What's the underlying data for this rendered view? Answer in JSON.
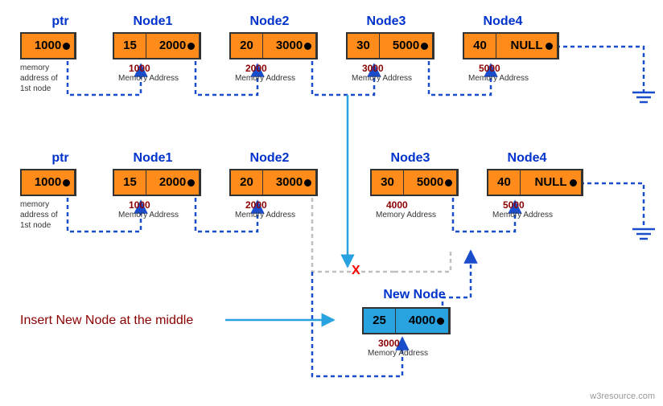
{
  "row1": {
    "ptr": {
      "label": "ptr",
      "value": "1000",
      "note": "memory\naddress of\n1st node"
    },
    "nodes": [
      {
        "label": "Node1",
        "data": "15",
        "next": "2000",
        "addr": "1000",
        "sub": "Memory Address"
      },
      {
        "label": "Node2",
        "data": "20",
        "next": "3000",
        "addr": "2000",
        "sub": "Memory Address"
      },
      {
        "label": "Node3",
        "data": "30",
        "next": "5000",
        "addr": "3000",
        "sub": "Memory Address"
      },
      {
        "label": "Node4",
        "data": "40",
        "next": "NULL",
        "addr": "5000",
        "sub": "Memory Address"
      }
    ]
  },
  "row2": {
    "ptr": {
      "label": "ptr",
      "value": "1000",
      "note": "memory\naddress of\n1st node"
    },
    "nodes": [
      {
        "label": "Node1",
        "data": "15",
        "next": "2000",
        "addr": "1000",
        "sub": "Memory Address"
      },
      {
        "label": "Node2",
        "data": "20",
        "next": "3000",
        "addr": "2000",
        "sub": "Memory Address"
      },
      {
        "label": "Node3",
        "data": "30",
        "next": "5000",
        "addr": "4000",
        "sub": "Memory Address"
      },
      {
        "label": "Node4",
        "data": "40",
        "next": "NULL",
        "addr": "5000",
        "sub": "Memory Address"
      }
    ]
  },
  "newNode": {
    "label": "New Node",
    "data": "25",
    "next": "4000",
    "addr": "3000",
    "sub": "Memory Address"
  },
  "insertText": "Insert New Node at the middle",
  "xmark": "X",
  "attribution": "w3resource.com"
}
